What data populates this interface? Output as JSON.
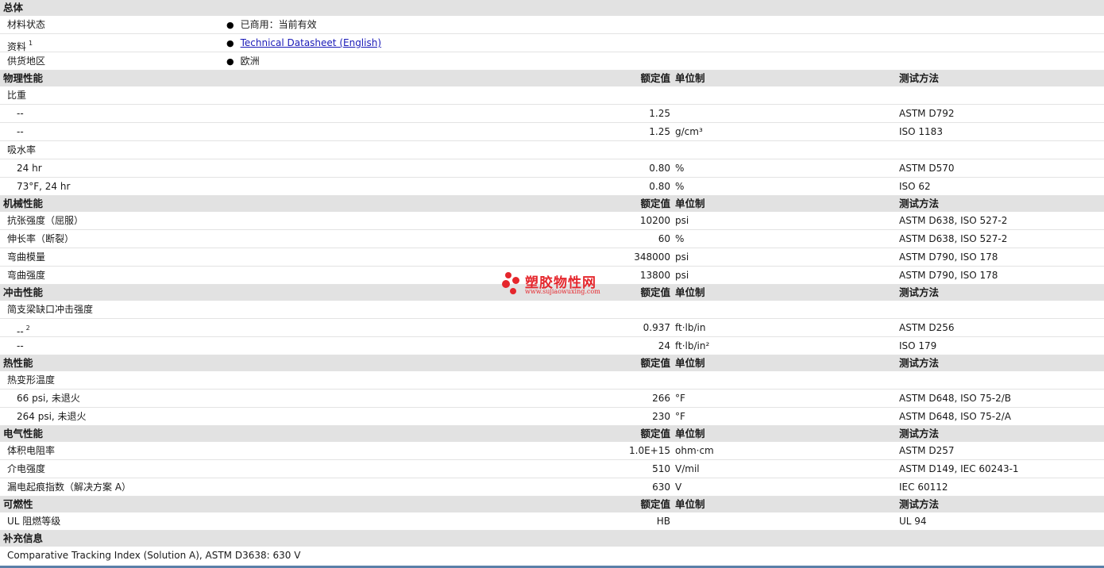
{
  "general": {
    "title": "总体",
    "rows": [
      {
        "label": "材料状态",
        "value": "已商用：当前有效"
      },
      {
        "label": "资料",
        "sup": "1",
        "value": "Technical Datasheet (English)"
      },
      {
        "label": "供货地区",
        "value": "欧洲"
      }
    ]
  },
  "headers": {
    "value": "额定值",
    "unit": "单位制",
    "test": "测试方法"
  },
  "physical": {
    "title": "物理性能",
    "specific_gravity": "比重",
    "sg_rows": [
      {
        "label": "--",
        "value": "1.25",
        "unit": "",
        "test": "ASTM D792"
      },
      {
        "label": "--",
        "value": "1.25",
        "unit": "g/cm³",
        "test": "ISO 1183"
      }
    ],
    "water_absorption": "吸水率",
    "wa_rows": [
      {
        "label": "24 hr",
        "value": "0.80",
        "unit": "%",
        "test": "ASTM D570"
      },
      {
        "label": "73°F, 24 hr",
        "value": "0.80",
        "unit": "%",
        "test": "ISO 62"
      }
    ]
  },
  "mechanical": {
    "title": "机械性能",
    "rows": [
      {
        "label": "抗张强度（屈服）",
        "value": "10200",
        "unit": "psi",
        "test": "ASTM D638, ISO 527-2"
      },
      {
        "label": "伸长率（断裂）",
        "value": "60",
        "unit": "%",
        "test": "ASTM D638, ISO 527-2"
      },
      {
        "label": "弯曲模量",
        "value": "348000",
        "unit": "psi",
        "test": "ASTM D790, ISO 178"
      },
      {
        "label": "弯曲强度",
        "value": "13800",
        "unit": "psi",
        "test": "ASTM D790, ISO 178"
      }
    ]
  },
  "impact": {
    "title": "冲击性能",
    "sub": "简支梁缺口冲击强度",
    "rows": [
      {
        "label": "--",
        "sup": "2",
        "value": "0.937",
        "unit": "ft·lb/in",
        "test": "ASTM D256"
      },
      {
        "label": "--",
        "value": "24",
        "unit": "ft·lb/in²",
        "test": "ISO 179"
      }
    ]
  },
  "thermal": {
    "title": "热性能",
    "sub": "热变形温度",
    "rows": [
      {
        "label": "66 psi, 未退火",
        "value": "266",
        "unit": "°F",
        "test": "ASTM D648, ISO 75-2/B"
      },
      {
        "label": "264 psi, 未退火",
        "value": "230",
        "unit": "°F",
        "test": "ASTM D648, ISO 75-2/A"
      }
    ]
  },
  "electrical": {
    "title": "电气性能",
    "rows": [
      {
        "label": "体积电阻率",
        "value": "1.0E+15",
        "unit": "ohm·cm",
        "test": "ASTM D257"
      },
      {
        "label": "介电强度",
        "value": "510",
        "unit": "V/mil",
        "test": "ASTM D149, IEC 60243-1"
      },
      {
        "label": "漏电起痕指数（解决方案  A）",
        "value": "630",
        "unit": "V",
        "test": "IEC 60112"
      }
    ]
  },
  "flammability": {
    "title": "可燃性",
    "rows": [
      {
        "label": "UL 阻燃等级",
        "value": "HB",
        "unit": "",
        "test": "UL 94"
      }
    ]
  },
  "supplement": {
    "title": "补充信息",
    "text": "Comparative Tracking Index (Solution A), ASTM D3638: 630 V"
  },
  "watermark": {
    "cn": "塑胶物性网",
    "en": "www.sujiaowuxing.com",
    "color": "#e5262c"
  }
}
